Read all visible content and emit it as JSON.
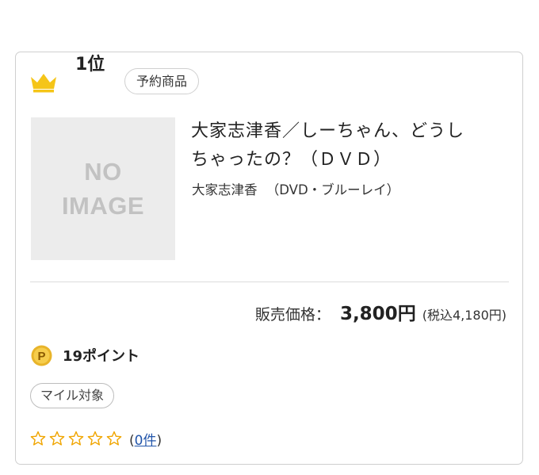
{
  "rank": {
    "label": "1位",
    "crown_color": "#f5c518"
  },
  "badge": {
    "label": "予約商品"
  },
  "image": {
    "line1": "NO",
    "line2": "IMAGE"
  },
  "product": {
    "title_line1": "大家志津香／しーちゃん、どうし",
    "title_line2": "ちゃったの？（ＤＶＤ）",
    "artist": "大家志津香",
    "category": "（DVD・ブルーレイ）"
  },
  "price": {
    "label": "販売価格：",
    "value": "3,800円",
    "tax_included": "(税込4,180円)"
  },
  "points": {
    "icon": "points-coin-icon",
    "icon_letter": "P",
    "label": "19ポイント",
    "coin_color": "#e8b42a"
  },
  "mile": {
    "label": "マイル対象"
  },
  "rating": {
    "stars_filled": 0,
    "stars_total": 5,
    "star_color": "#f0a500",
    "open_paren": "(",
    "count": "0件",
    "close_paren": ")",
    "link_color": "#2255aa"
  }
}
